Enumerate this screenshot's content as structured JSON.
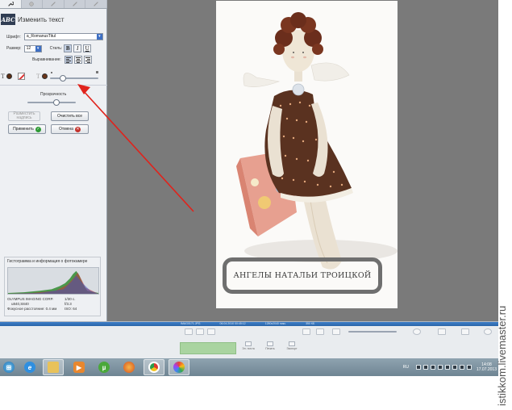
{
  "panel": {
    "title": "Изменить текст",
    "abc_badge": "ABC",
    "font_label": "Шрифт:",
    "font_value": "a_RomanusTitul",
    "size_label": "Размер:",
    "size_value": "12",
    "style_label": "Стиль:",
    "style_bold": "B",
    "style_italic": "I",
    "style_underline": "U",
    "align_label": "Выравнивание:",
    "text_glyph": "T",
    "opacity_label": "Прозрачность",
    "btn_add": "Разместить надпись",
    "btn_clear": "Очистить все",
    "btn_apply": "Применить",
    "btn_cancel": "Отмена",
    "colors": {
      "text_color": "#5a2c12",
      "no_fill": "#d33",
      "accent": "#3d6fc4"
    },
    "histogram": {
      "title": "Гистограмма и информация о фотокамере",
      "camera": "OLYMPUS IMAGING CORP.",
      "model": "u840,S840",
      "exposure": "1/30 с.",
      "aperture": "f/3.3",
      "focal": "Фокусное расстояние: 0.4 мм",
      "iso": "ISO: 64"
    }
  },
  "photo": {
    "caption": "АНГЕЛЫ НАТАЛЬИ ТРОИЦКОЙ"
  },
  "bottom": {
    "status": [
      "IMAG0171.JPG",
      "06.04.2010 00:45:12",
      "1280x2040 пикс.",
      "350 КБ"
    ],
    "actions": [
      "Эл. почта",
      "Печать",
      "Экспорт"
    ]
  },
  "taskbar": {
    "language": "RU",
    "time": "14:08",
    "date": "17.07.2013",
    "apps": [
      "start-orb",
      "internet-explorer",
      "file-explorer",
      "media-player",
      "utorrent",
      "firefox",
      "chrome",
      "picasa"
    ]
  },
  "side_watermark": "istikkom.livemaster.ru"
}
